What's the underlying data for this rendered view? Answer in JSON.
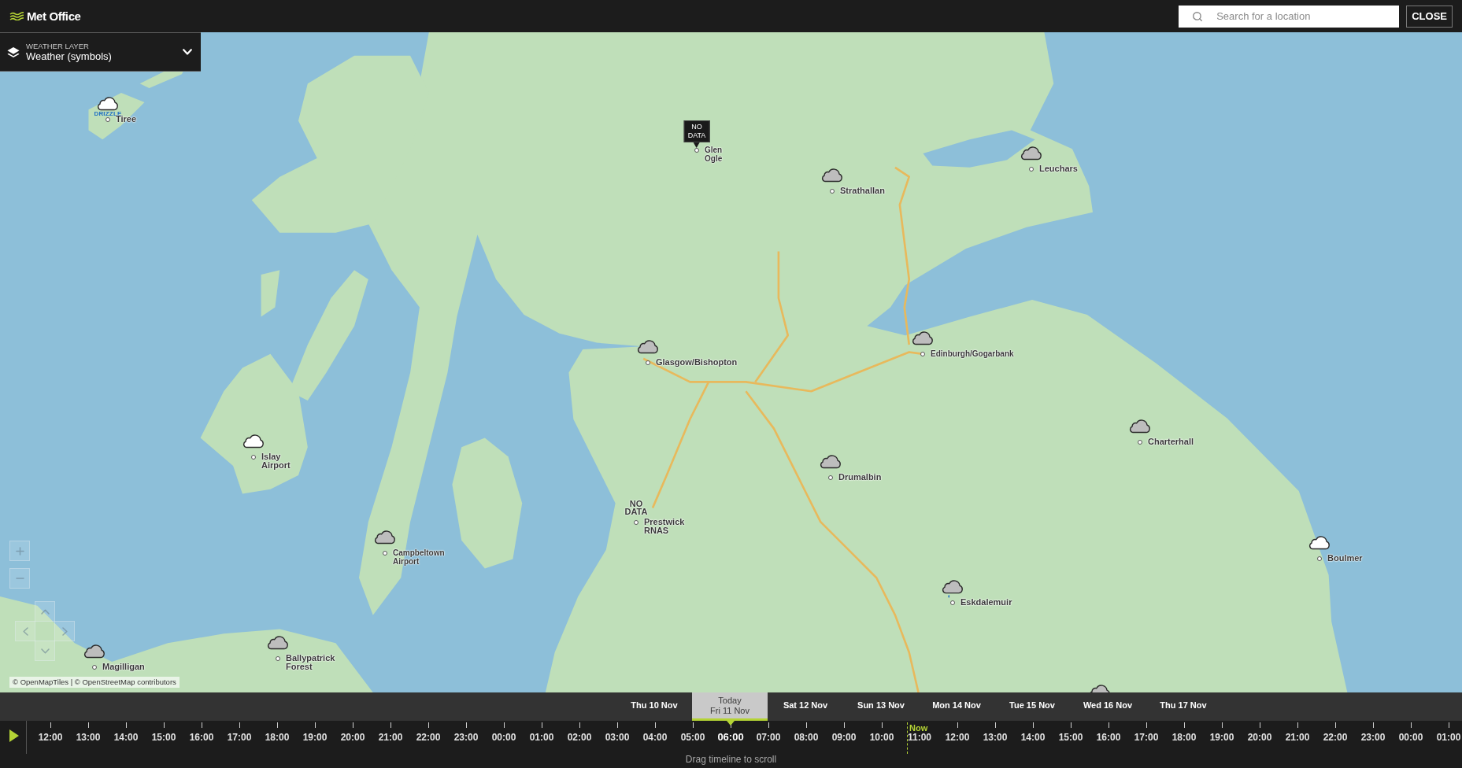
{
  "header": {
    "logo": "Met Office",
    "search": {
      "placeholder": "Search for a location"
    },
    "close_button": "CLOSE"
  },
  "layer_selector": {
    "caption": "WEATHER LAYER",
    "value": "Weather (symbols)",
    "expanded": false
  },
  "map": {
    "markers": [
      {
        "kind": "light-cloud",
        "caption": "DRIZZLE",
        "name": "Tiree"
      },
      {
        "kind": "no-data-tag",
        "caption": "NO DATA",
        "name": "Glen Ogle"
      },
      {
        "kind": "dark-cloud",
        "name": "Leuchars"
      },
      {
        "kind": "dark-cloud",
        "name": "Strathallan"
      },
      {
        "kind": "dark-cloud",
        "name": "Glasgow/Bishopton"
      },
      {
        "kind": "dark-cloud",
        "name": "Edinburgh/Gogarbank"
      },
      {
        "kind": "dark-cloud",
        "name": "Charterhall"
      },
      {
        "kind": "light-cloud",
        "name": "Islay Airport"
      },
      {
        "kind": "dark-cloud",
        "name": "Drumalbin"
      },
      {
        "kind": "no-data-text",
        "caption": "NO DATA",
        "name": "Prestwick RNAS"
      },
      {
        "kind": "dark-cloud",
        "name": "Campbeltown Airport"
      },
      {
        "kind": "light-cloud",
        "name": "Boulmer"
      },
      {
        "kind": "rain-cloud",
        "name": "Eskdalemuir"
      },
      {
        "kind": "dark-cloud",
        "name": "Magilligan"
      },
      {
        "kind": "dark-cloud",
        "name": "Ballypatrick Forest"
      },
      {
        "kind": "dark-cloud"
      }
    ],
    "attribution": "© OpenMapTiles | © OpenStreetMap contributors"
  },
  "timeline": {
    "playing": false,
    "days": [
      {
        "label": "Thu 10 Nov",
        "selected": false
      },
      {
        "label": "Today",
        "sublabel": "Fri 11 Nov",
        "selected": true
      },
      {
        "label": "Sat 12 Nov",
        "selected": false
      },
      {
        "label": "Sun 13 Nov",
        "selected": false
      },
      {
        "label": "Mon 14 Nov",
        "selected": false
      },
      {
        "label": "Tue 15 Nov",
        "selected": false
      },
      {
        "label": "Wed 16 Nov",
        "selected": false
      },
      {
        "label": "Thu 17 Nov",
        "selected": false
      }
    ],
    "hours": [
      {
        "time": "12:00",
        "selected": false,
        "now": false
      },
      {
        "time": "13:00",
        "selected": false,
        "now": false
      },
      {
        "time": "14:00",
        "selected": false,
        "now": false
      },
      {
        "time": "15:00",
        "selected": false,
        "now": false
      },
      {
        "time": "16:00",
        "selected": false,
        "now": false
      },
      {
        "time": "17:00",
        "selected": false,
        "now": false
      },
      {
        "time": "18:00",
        "selected": false,
        "now": false
      },
      {
        "time": "19:00",
        "selected": false,
        "now": false
      },
      {
        "time": "20:00",
        "selected": false,
        "now": false
      },
      {
        "time": "21:00",
        "selected": false,
        "now": false
      },
      {
        "time": "22:00",
        "selected": false,
        "now": false
      },
      {
        "time": "23:00",
        "selected": false,
        "now": false
      },
      {
        "time": "00:00",
        "selected": false,
        "now": false
      },
      {
        "time": "01:00",
        "selected": false,
        "now": false
      },
      {
        "time": "02:00",
        "selected": false,
        "now": false
      },
      {
        "time": "03:00",
        "selected": false,
        "now": false
      },
      {
        "time": "04:00",
        "selected": false,
        "now": false
      },
      {
        "time": "05:00",
        "selected": false,
        "now": false
      },
      {
        "time": "06:00",
        "selected": true,
        "now": false
      },
      {
        "time": "07:00",
        "selected": false,
        "now": false
      },
      {
        "time": "08:00",
        "selected": false,
        "now": false
      },
      {
        "time": "09:00",
        "selected": false,
        "now": false
      },
      {
        "time": "10:00",
        "selected": false,
        "now": false
      },
      {
        "time": "11:00",
        "selected": false,
        "now": true
      },
      {
        "time": "12:00",
        "selected": false,
        "now": false
      },
      {
        "time": "13:00",
        "selected": false,
        "now": false
      },
      {
        "time": "14:00",
        "selected": false,
        "now": false
      },
      {
        "time": "15:00",
        "selected": false,
        "now": false
      },
      {
        "time": "16:00",
        "selected": false,
        "now": false
      },
      {
        "time": "17:00",
        "selected": false,
        "now": false
      },
      {
        "time": "18:00",
        "selected": false,
        "now": false
      },
      {
        "time": "19:00",
        "selected": false,
        "now": false
      },
      {
        "time": "20:00",
        "selected": false,
        "now": false
      },
      {
        "time": "21:00",
        "selected": false,
        "now": false
      },
      {
        "time": "22:00",
        "selected": false,
        "now": false
      },
      {
        "time": "23:00",
        "selected": false,
        "now": false
      },
      {
        "time": "00:00",
        "selected": false,
        "now": false
      },
      {
        "time": "01:00",
        "selected": false,
        "now": false
      }
    ],
    "now_label": "Now",
    "hint": "Drag timeline to scroll"
  }
}
